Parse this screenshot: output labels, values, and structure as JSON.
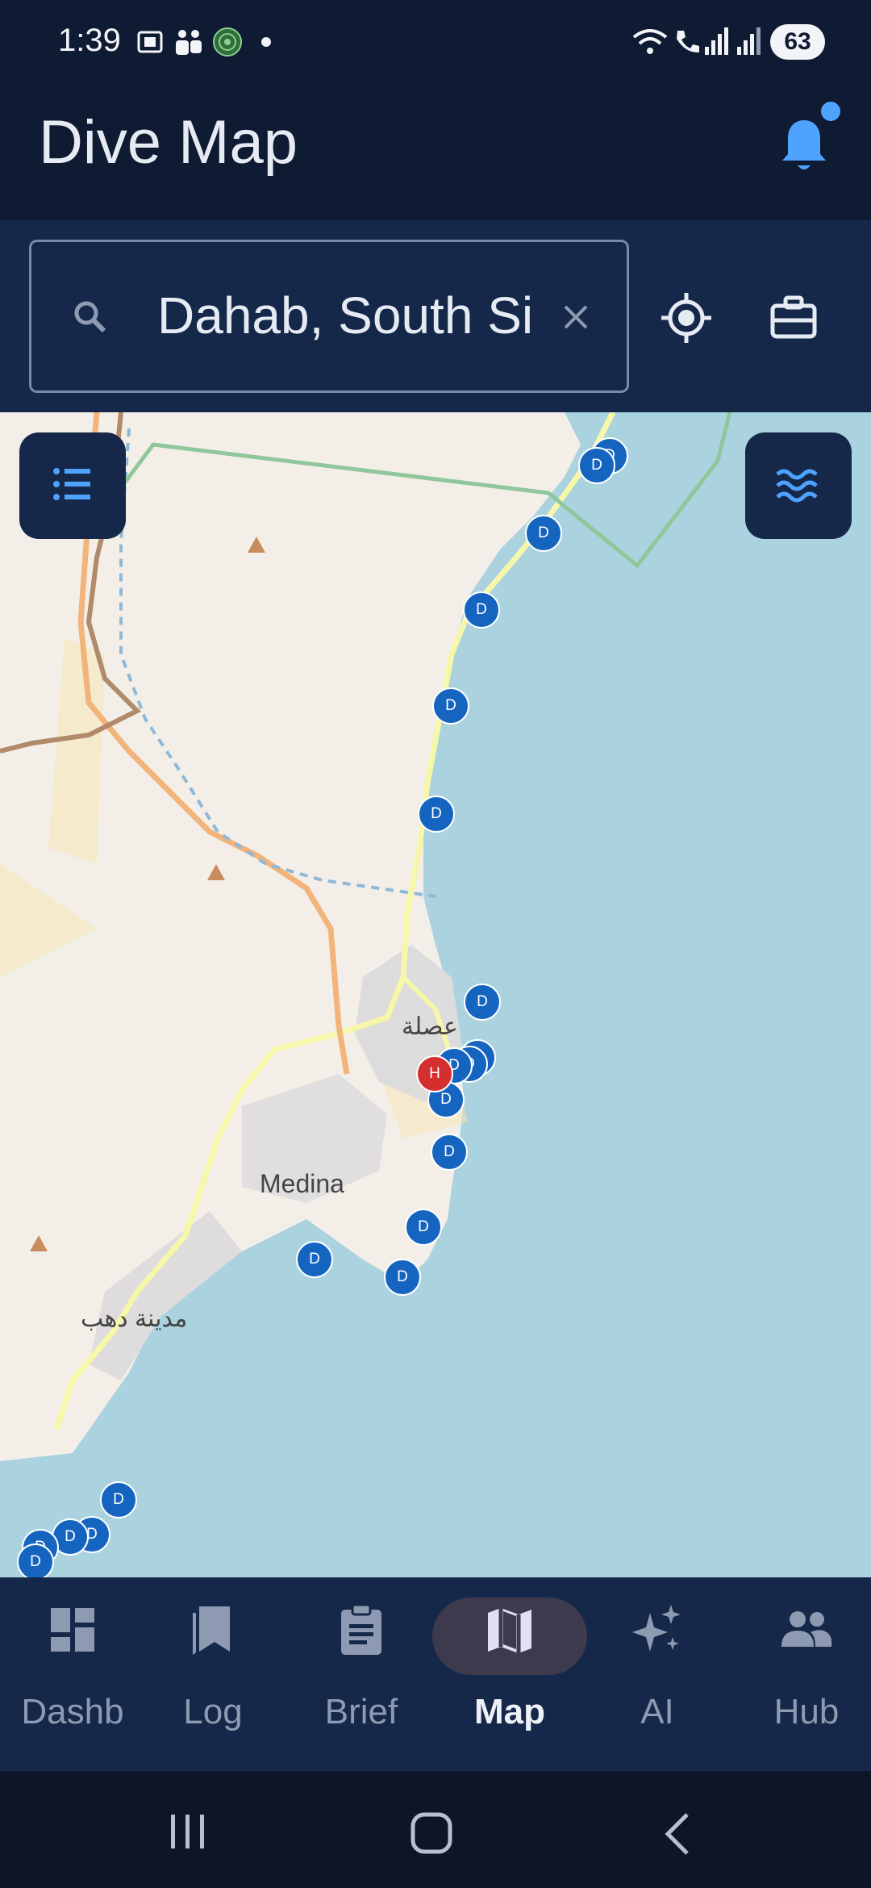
{
  "status_bar": {
    "time": "1:39",
    "battery": "63"
  },
  "app_bar": {
    "title": "Dive Map"
  },
  "search": {
    "value": "Dahab, South Sinai, Egypt"
  },
  "map": {
    "labels": {
      "city_ar": "مدينة دهب",
      "medina": "Medina",
      "asala_ar": "عصلة"
    },
    "dive_marker_letter": "D",
    "hotel_marker_letter": "H"
  },
  "bottom_nav": {
    "items": [
      {
        "label": "Dashb",
        "icon": "dashboard-icon",
        "active": false
      },
      {
        "label": "Log",
        "icon": "log-book-icon",
        "active": false
      },
      {
        "label": "Brief",
        "icon": "clipboard-icon",
        "active": false
      },
      {
        "label": "Map",
        "icon": "map-icon",
        "active": true
      },
      {
        "label": "AI",
        "icon": "sparkle-icon",
        "active": false
      },
      {
        "label": "Hub",
        "icon": "people-icon",
        "active": false
      }
    ]
  },
  "colors": {
    "accent": "#4ea3ff",
    "header_bg": "#0f1b32",
    "panel_bg": "#15284a",
    "dive_pin": "#1565c0",
    "hotel_pin": "#d32f2f",
    "sea": "#aad3df"
  }
}
